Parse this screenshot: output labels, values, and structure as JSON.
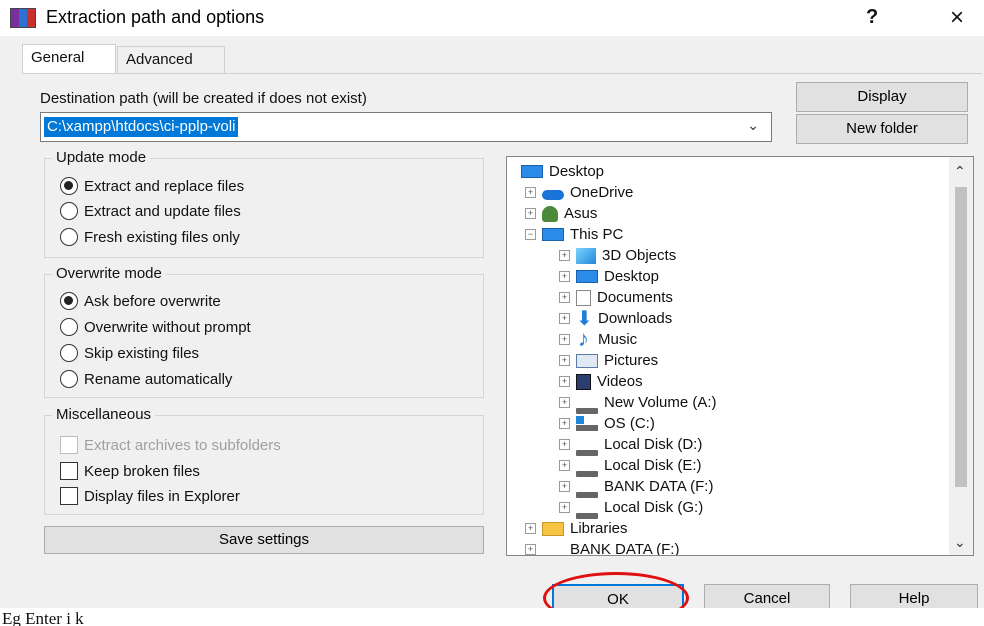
{
  "window": {
    "title": "Extraction path and options",
    "help_label": "?",
    "close_label": "×"
  },
  "tabs": [
    {
      "label": "General"
    },
    {
      "label": "Advanced"
    }
  ],
  "destination": {
    "label": "Destination path (will be created if does not exist)",
    "value": "C:\\xampp\\htdocs\\ci-pplp-voli",
    "dropdown_icon": "chevron-down-icon"
  },
  "buttons": {
    "display": "Display",
    "new_folder": "New folder",
    "save_settings": "Save settings",
    "ok": "OK",
    "cancel": "Cancel",
    "help": "Help"
  },
  "update_mode": {
    "title": "Update mode",
    "options": [
      {
        "label": "Extract and replace files",
        "selected": true
      },
      {
        "label": "Extract and update files",
        "selected": false
      },
      {
        "label": "Fresh existing files only",
        "selected": false
      }
    ]
  },
  "overwrite_mode": {
    "title": "Overwrite mode",
    "options": [
      {
        "label": "Ask before overwrite",
        "selected": true
      },
      {
        "label": "Overwrite without prompt",
        "selected": false
      },
      {
        "label": "Skip existing files",
        "selected": false
      },
      {
        "label": "Rename automatically",
        "selected": false
      }
    ]
  },
  "misc": {
    "title": "Miscellaneous",
    "options": [
      {
        "label": "Extract archives to subfolders",
        "checked": false,
        "disabled": true
      },
      {
        "label": "Keep broken files",
        "checked": false,
        "disabled": false
      },
      {
        "label": "Display files in Explorer",
        "checked": false,
        "disabled": false
      }
    ]
  },
  "tree": {
    "items": [
      {
        "label": "Desktop",
        "icon": "monitor-icon"
      },
      {
        "label": "OneDrive",
        "icon": "cloud-icon"
      },
      {
        "label": "Asus",
        "icon": "user-icon"
      },
      {
        "label": "This PC",
        "icon": "monitor-icon"
      },
      {
        "label": "3D Objects",
        "icon": "cube-icon"
      },
      {
        "label": "Desktop",
        "icon": "monitor-icon"
      },
      {
        "label": "Documents",
        "icon": "document-icon"
      },
      {
        "label": "Downloads",
        "icon": "download-icon"
      },
      {
        "label": "Music",
        "icon": "music-icon"
      },
      {
        "label": "Pictures",
        "icon": "picture-icon"
      },
      {
        "label": "Videos",
        "icon": "video-icon"
      },
      {
        "label": "New Volume (A:)",
        "icon": "drive-icon"
      },
      {
        "label": "OS (C:)",
        "icon": "os-drive-icon"
      },
      {
        "label": "Local Disk (D:)",
        "icon": "drive-icon"
      },
      {
        "label": "Local Disk (E:)",
        "icon": "drive-icon"
      },
      {
        "label": "BANK DATA (F:)",
        "icon": "drive-icon"
      },
      {
        "label": "Local Disk (G:)",
        "icon": "drive-icon"
      },
      {
        "label": "Libraries",
        "icon": "folder-icon"
      },
      {
        "label": "BANK DATA (F:)",
        "icon": "drive-icon"
      }
    ],
    "expanders": {
      "plus": "+",
      "minus": "−"
    }
  },
  "scroll": {
    "up": "⌃",
    "down": "⌄"
  },
  "caption": "Eg Enter i k"
}
